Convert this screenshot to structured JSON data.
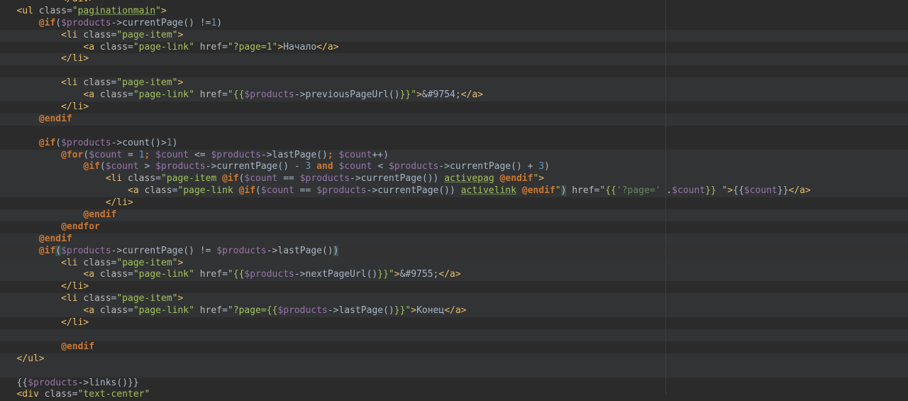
{
  "editor": {
    "lines": [
      {
        "indent": "        ",
        "tokens": [
          [
            "t",
            "</div>"
          ]
        ]
      },
      {
        "indent": "",
        "tokens": [
          [
            "t",
            "<ul "
          ],
          [
            "a",
            "class"
          ],
          [
            "p",
            "="
          ],
          [
            "s",
            "\""
          ],
          [
            "s u",
            "paginationmain"
          ],
          [
            "s",
            "\""
          ],
          [
            "t",
            ">"
          ]
        ]
      },
      {
        "indent": "    ",
        "tokens": [
          [
            "k",
            "@if"
          ],
          [
            "p",
            "("
          ],
          [
            "v",
            "$products"
          ],
          [
            "p",
            "->currentPage() !="
          ],
          [
            "n",
            "1"
          ],
          [
            "p",
            ")"
          ]
        ]
      },
      {
        "indent": "        ",
        "tokens": [
          [
            "t",
            "<li "
          ],
          [
            "a",
            "class"
          ],
          [
            "p",
            "="
          ],
          [
            "s",
            "\"page-item\""
          ],
          [
            "t",
            ">"
          ]
        ]
      },
      {
        "indent": "            ",
        "tokens": [
          [
            "t",
            "<a "
          ],
          [
            "a",
            "class"
          ],
          [
            "p",
            "="
          ],
          [
            "s",
            "\"page-link\" "
          ],
          [
            "a",
            "href"
          ],
          [
            "p",
            "="
          ],
          [
            "s",
            "\"?page=1\""
          ],
          [
            "t",
            ">"
          ],
          [
            "p",
            "Начало"
          ],
          [
            "t",
            "</a>"
          ]
        ]
      },
      {
        "indent": "        ",
        "tokens": [
          [
            "t",
            "</li>"
          ]
        ]
      },
      {
        "indent": "",
        "tokens": []
      },
      {
        "indent": "        ",
        "tokens": [
          [
            "t",
            "<li "
          ],
          [
            "a",
            "class"
          ],
          [
            "p",
            "="
          ],
          [
            "s",
            "\"page-item\""
          ],
          [
            "t",
            ">"
          ]
        ]
      },
      {
        "indent": "            ",
        "tokens": [
          [
            "t",
            "<a "
          ],
          [
            "a",
            "class"
          ],
          [
            "p",
            "="
          ],
          [
            "s",
            "\"page-link\" "
          ],
          [
            "a",
            "href"
          ],
          [
            "p",
            "="
          ],
          [
            "s",
            "\"{{"
          ],
          [
            "v",
            "$products"
          ],
          [
            "p",
            "->previousPageUrl()"
          ],
          [
            "s",
            "}}\""
          ],
          [
            "t",
            ">"
          ],
          [
            "p",
            "&#9754;"
          ],
          [
            "t",
            "</a>"
          ]
        ]
      },
      {
        "indent": "        ",
        "tokens": [
          [
            "t",
            "</li>"
          ]
        ]
      },
      {
        "indent": "    ",
        "tokens": [
          [
            "k",
            "@endif"
          ]
        ]
      },
      {
        "indent": "",
        "tokens": []
      },
      {
        "indent": "    ",
        "tokens": [
          [
            "k",
            "@if"
          ],
          [
            "p",
            "("
          ],
          [
            "v",
            "$products"
          ],
          [
            "p",
            "->count()>"
          ],
          [
            "n",
            "1"
          ],
          [
            "p",
            ")"
          ]
        ]
      },
      {
        "indent": "        ",
        "tokens": [
          [
            "k",
            "@for"
          ],
          [
            "p",
            "("
          ],
          [
            "v",
            "$count"
          ],
          [
            "p",
            " = "
          ],
          [
            "n",
            "1"
          ],
          [
            "k",
            "; "
          ],
          [
            "v",
            "$count"
          ],
          [
            "p",
            " <= "
          ],
          [
            "v",
            "$products"
          ],
          [
            "p",
            "->lastPage()"
          ],
          [
            "k",
            "; "
          ],
          [
            "v",
            "$count"
          ],
          [
            "p",
            "++)"
          ]
        ]
      },
      {
        "indent": "            ",
        "tokens": [
          [
            "k",
            "@if"
          ],
          [
            "p",
            "("
          ],
          [
            "v",
            "$count"
          ],
          [
            "p",
            " > "
          ],
          [
            "v",
            "$products"
          ],
          [
            "p",
            "->currentPage() - "
          ],
          [
            "n",
            "3"
          ],
          [
            "k",
            " and "
          ],
          [
            "v",
            "$count"
          ],
          [
            "p",
            " < "
          ],
          [
            "v",
            "$products"
          ],
          [
            "p",
            "->currentPage() + "
          ],
          [
            "n",
            "3"
          ],
          [
            "p",
            ")"
          ]
        ]
      },
      {
        "indent": "                ",
        "tokens": [
          [
            "t",
            "<li "
          ],
          [
            "a",
            "class"
          ],
          [
            "p",
            "="
          ],
          [
            "s",
            "\"page-item "
          ],
          [
            "k",
            "@if"
          ],
          [
            "p",
            "("
          ],
          [
            "v",
            "$count"
          ],
          [
            "p",
            " == "
          ],
          [
            "v",
            "$products"
          ],
          [
            "p",
            "->currentPage()) "
          ],
          [
            "s u",
            "activepag"
          ],
          [
            "k",
            " @endif"
          ],
          [
            "s",
            "\""
          ],
          [
            "t",
            ">"
          ]
        ]
      },
      {
        "indent": "                    ",
        "tokens": [
          [
            "t",
            "<a "
          ],
          [
            "a",
            "class"
          ],
          [
            "p",
            "="
          ],
          [
            "s",
            "\"page-link "
          ],
          [
            "k",
            "@if"
          ],
          [
            "p",
            "("
          ],
          [
            "v",
            "$count"
          ],
          [
            "p",
            " == "
          ],
          [
            "v",
            "$products"
          ],
          [
            "p",
            "->currentPage()) "
          ],
          [
            "s u",
            "activelink"
          ],
          [
            "k",
            " @endif"
          ],
          [
            "s",
            "\""
          ],
          [
            "p m",
            ")"
          ],
          [
            "a",
            " href"
          ],
          [
            "p",
            "="
          ],
          [
            "s",
            "\"{{"
          ],
          [
            "g",
            "'?page='"
          ],
          [
            "p",
            " ."
          ],
          [
            "v",
            "$count"
          ],
          [
            "s",
            "}} \""
          ],
          [
            "t",
            ">"
          ],
          [
            "p",
            "{{"
          ],
          [
            "v",
            "$count"
          ],
          [
            "p",
            "}}"
          ],
          [
            "t",
            "</a>"
          ]
        ]
      },
      {
        "indent": "                ",
        "tokens": [
          [
            "t",
            "</li>"
          ]
        ]
      },
      {
        "indent": "            ",
        "tokens": [
          [
            "k",
            "@endif"
          ]
        ]
      },
      {
        "indent": "        ",
        "tokens": [
          [
            "k",
            "@endfor"
          ]
        ]
      },
      {
        "indent": "    ",
        "tokens": [
          [
            "k",
            "@endif"
          ]
        ]
      },
      {
        "indent": "    ",
        "tokens": [
          [
            "k",
            "@if"
          ],
          [
            "p m",
            "("
          ],
          [
            "v",
            "$products"
          ],
          [
            "p",
            "->currentPage() != "
          ],
          [
            "v",
            "$products"
          ],
          [
            "p",
            "->lastPage()"
          ],
          [
            "p m",
            ")"
          ]
        ]
      },
      {
        "indent": "        ",
        "tokens": [
          [
            "t",
            "<li "
          ],
          [
            "a",
            "class"
          ],
          [
            "p",
            "="
          ],
          [
            "s",
            "\"page-item\""
          ],
          [
            "t",
            ">"
          ]
        ]
      },
      {
        "indent": "            ",
        "tokens": [
          [
            "t",
            "<a "
          ],
          [
            "a",
            "class"
          ],
          [
            "p",
            "="
          ],
          [
            "s",
            "\"page-link\" "
          ],
          [
            "a",
            "href"
          ],
          [
            "p",
            "="
          ],
          [
            "s",
            "\"{{"
          ],
          [
            "v",
            "$products"
          ],
          [
            "p",
            "->nextPageUrl()"
          ],
          [
            "s",
            "}}\""
          ],
          [
            "t",
            ">"
          ],
          [
            "p",
            "&#9755;"
          ],
          [
            "t",
            "</a>"
          ]
        ]
      },
      {
        "indent": "        ",
        "tokens": [
          [
            "t",
            "</li>"
          ]
        ]
      },
      {
        "indent": "        ",
        "tokens": [
          [
            "t",
            "<li "
          ],
          [
            "a",
            "class"
          ],
          [
            "p",
            "="
          ],
          [
            "s",
            "\"page-item\""
          ],
          [
            "t",
            ">"
          ]
        ]
      },
      {
        "indent": "            ",
        "tokens": [
          [
            "t",
            "<a "
          ],
          [
            "a",
            "class"
          ],
          [
            "p",
            "="
          ],
          [
            "s",
            "\"page-link\" "
          ],
          [
            "a",
            "href"
          ],
          [
            "p",
            "="
          ],
          [
            "s",
            "\"?page={{"
          ],
          [
            "v",
            "$products"
          ],
          [
            "p",
            "->lastPage()"
          ],
          [
            "s",
            "}}\""
          ],
          [
            "t",
            ">"
          ],
          [
            "p",
            "Конец"
          ],
          [
            "t",
            "</a>"
          ]
        ]
      },
      {
        "indent": "        ",
        "tokens": [
          [
            "t",
            "</li>"
          ]
        ]
      },
      {
        "indent": "",
        "tokens": []
      },
      {
        "indent": "        ",
        "tokens": [
          [
            "k",
            "@endif"
          ]
        ]
      },
      {
        "indent": "",
        "tokens": [
          [
            "t",
            "</ul>"
          ]
        ]
      },
      {
        "indent": "",
        "tokens": []
      },
      {
        "indent": "",
        "tokens": [
          [
            "p",
            "{{"
          ],
          [
            "v",
            "$products"
          ],
          [
            "p",
            "->links()}}"
          ]
        ]
      },
      {
        "indent": "",
        "tokens": [
          [
            "t",
            "<div "
          ],
          [
            "a",
            "class"
          ],
          [
            "p",
            "="
          ],
          [
            "s",
            "\"text-center\""
          ]
        ]
      }
    ]
  }
}
